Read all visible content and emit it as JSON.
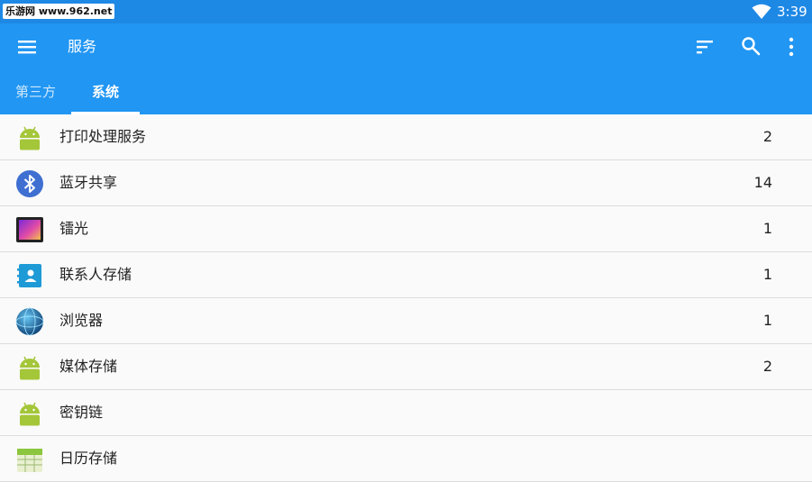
{
  "statusbar": {
    "watermark": "乐游网 www.962.net",
    "time": "3:39"
  },
  "appbar": {
    "title": "服务"
  },
  "tabs": [
    {
      "label": "第三方",
      "active": false
    },
    {
      "label": "系统",
      "active": true
    }
  ],
  "colors": {
    "primary": "#2196f3",
    "statusbar": "#1e88e5",
    "android_green": "#a4c639"
  },
  "items": [
    {
      "label": "打印处理服务",
      "count": "2",
      "icon": "android-icon"
    },
    {
      "label": "蓝牙共享",
      "count": "14",
      "icon": "bluetooth-icon"
    },
    {
      "label": "镭光",
      "count": "1",
      "icon": "wallpaper-icon"
    },
    {
      "label": "联系人存储",
      "count": "1",
      "icon": "contacts-icon"
    },
    {
      "label": "浏览器",
      "count": "1",
      "icon": "browser-globe-icon"
    },
    {
      "label": "媒体存储",
      "count": "2",
      "icon": "android-icon"
    },
    {
      "label": "密钥链",
      "count": "",
      "icon": "android-icon"
    },
    {
      "label": "日历存储",
      "count": "",
      "icon": "calendar-icon"
    }
  ]
}
